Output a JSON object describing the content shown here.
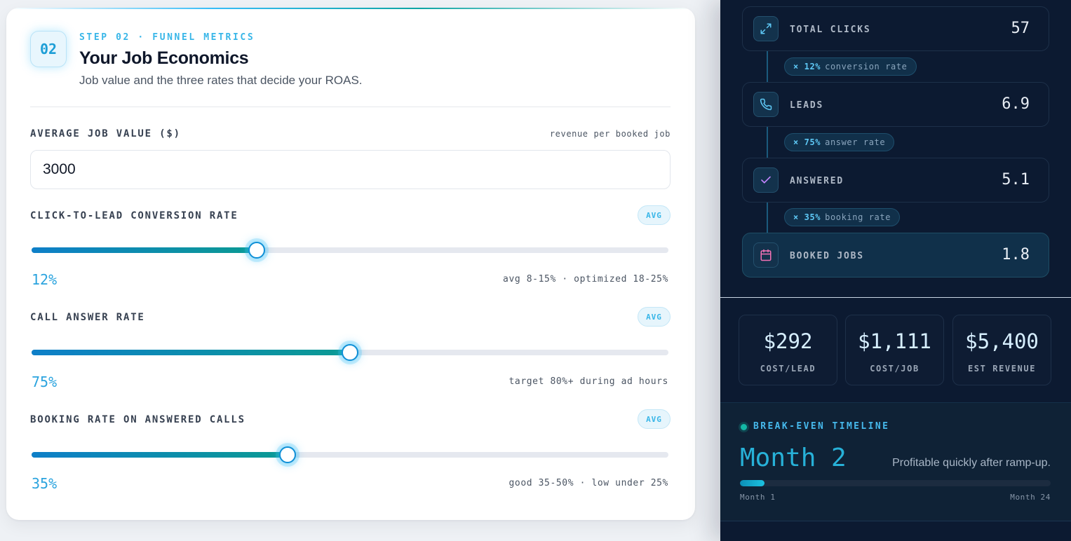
{
  "economics": {
    "step_number": "02",
    "step_label": "STEP 02 · FUNNEL METRICS",
    "title": "Your Job Economics",
    "subtitle": "Job value and the three rates that decide your ROAS.",
    "job_value": {
      "label": "AVERAGE JOB VALUE ($)",
      "hint": "revenue per booked job",
      "value": "3000"
    },
    "sliders": [
      {
        "label": "CLICK-TO-LEAD CONVERSION RATE",
        "badge": "AVG",
        "value_text": "12%",
        "fill_percent": 35.4,
        "range_hint": "avg 8-15% · optimized 18-25%"
      },
      {
        "label": "CALL ANSWER RATE",
        "badge": "AVG",
        "value_text": "75%",
        "fill_percent": 50,
        "range_hint": "target 80%+ during ad hours"
      },
      {
        "label": "BOOKING RATE ON ANSWERED CALLS",
        "badge": "AVG",
        "value_text": "35%",
        "fill_percent": 40.2,
        "range_hint": "good 35-50% · low under 25%"
      }
    ]
  },
  "funnel": {
    "steps": [
      {
        "label": "TOTAL CLICKS",
        "value": "57",
        "icon": "expand-icon"
      },
      {
        "label": "LEADS",
        "value": "6.9",
        "icon": "phone-icon"
      },
      {
        "label": "ANSWERED",
        "value": "5.1",
        "icon": "check-icon"
      },
      {
        "label": "BOOKED JOBS",
        "value": "1.8",
        "icon": "calendar-icon"
      }
    ],
    "rates": [
      {
        "rate": "× 12%",
        "text": "conversion rate"
      },
      {
        "rate": "× 75%",
        "text": "answer rate"
      },
      {
        "rate": "× 35%",
        "text": "booking rate"
      }
    ]
  },
  "stats": [
    {
      "value": "$292",
      "label": "COST/LEAD"
    },
    {
      "value": "$1,111",
      "label": "COST/JOB"
    },
    {
      "value": "$5,400",
      "label": "EST REVENUE"
    }
  ],
  "timeline": {
    "label": "BREAK-EVEN TIMELINE",
    "value": "Month 2",
    "note": "Profitable quickly after ramp-up.",
    "min_label": "Month 1",
    "max_label": "Month 24",
    "progress_fraction": 0.08
  },
  "colors": {
    "accent": "#38b6e8",
    "panel_bg": "#0c1a31",
    "teal": "#14b8a6",
    "check_icon": "#c084fc",
    "calendar_icon": "#f472b6"
  }
}
